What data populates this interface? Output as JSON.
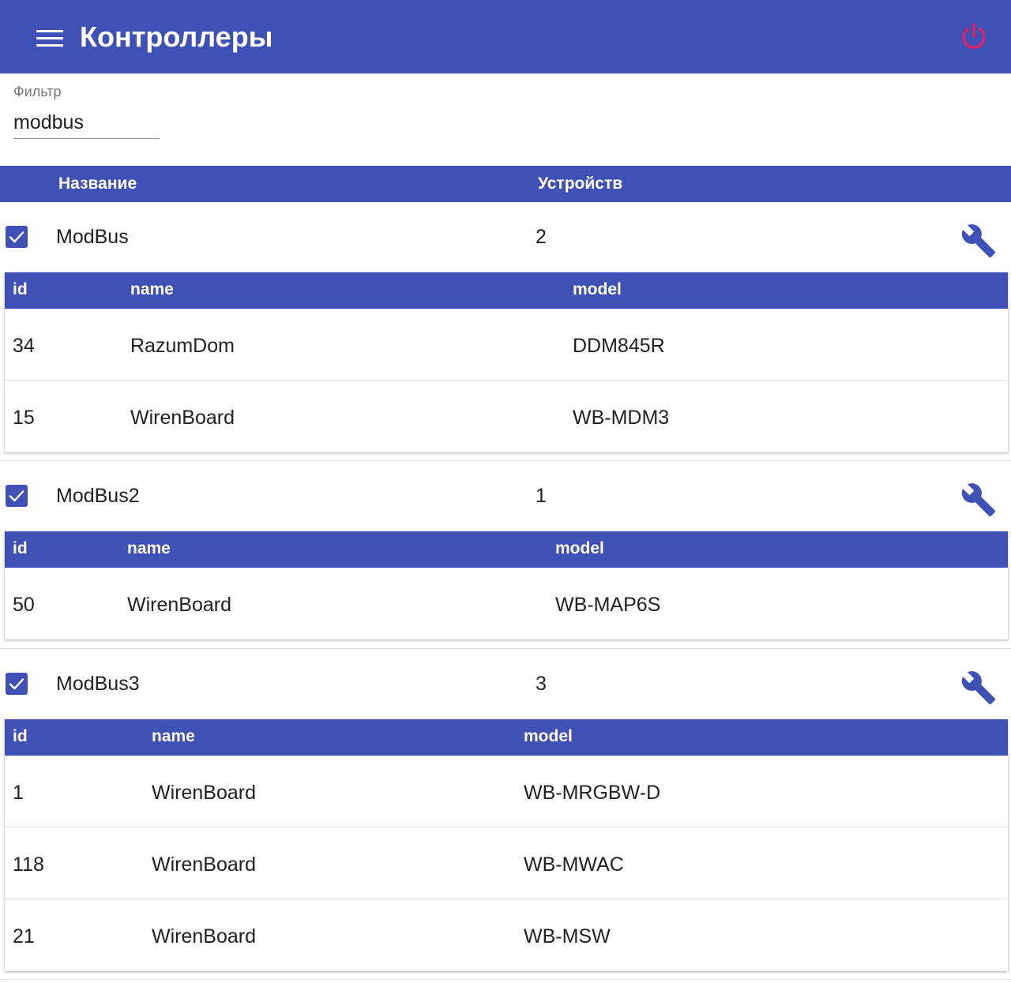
{
  "appbar": {
    "title": "Контроллеры"
  },
  "filter": {
    "label": "Фильтр",
    "value": "modbus"
  },
  "table": {
    "col_name": "Название",
    "col_count": "Устройств"
  },
  "controllers": [
    {
      "name": "ModBus",
      "count": "2",
      "checked": true,
      "headers": {
        "id": "id",
        "name": "name",
        "model": "model"
      },
      "devices": [
        {
          "id": "34",
          "name": "RazumDom",
          "model": "DDM845R"
        },
        {
          "id": "15",
          "name": "WirenBoard",
          "model": "WB-MDM3"
        }
      ]
    },
    {
      "name": "ModBus2",
      "count": "1",
      "checked": true,
      "headers": {
        "id": "id",
        "name": "name",
        "model": "model"
      },
      "devices": [
        {
          "id": "50",
          "name": "WirenBoard",
          "model": "WB-MAP6S"
        }
      ]
    },
    {
      "name": "ModBus3",
      "count": "3",
      "checked": true,
      "headers": {
        "id": "id",
        "name": "name",
        "model": "model"
      },
      "devices": [
        {
          "id": "1",
          "name": "WirenBoard",
          "model": "WB-MRGBW-D"
        },
        {
          "id": "118",
          "name": "WirenBoard",
          "model": "WB-MWAC"
        },
        {
          "id": "21",
          "name": "WirenBoard",
          "model": "WB-MSW"
        }
      ]
    }
  ],
  "colors": {
    "primary": "#3f51b5",
    "power": "#e91e63"
  },
  "icons": {
    "menu": "menu-icon",
    "power": "power-icon",
    "check": "check-icon",
    "settings": "wrench-icon"
  }
}
